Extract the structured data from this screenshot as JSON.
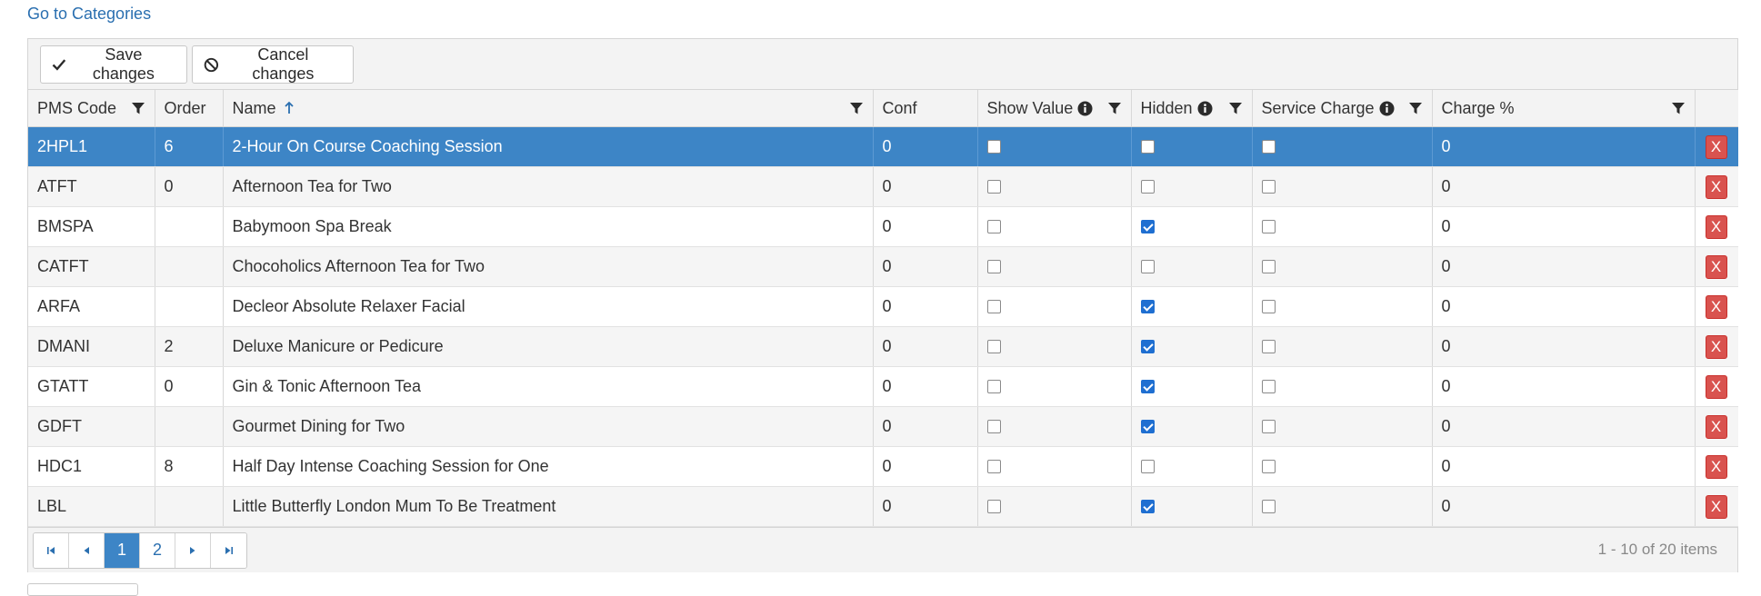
{
  "top_link": "Go to Categories",
  "toolbar": {
    "save_label": "Save changes",
    "cancel_label": "Cancel changes"
  },
  "columns": {
    "pms_code": "PMS Code",
    "order": "Order",
    "name": "Name",
    "conf": "Conf",
    "show_value": "Show Value",
    "hidden": "Hidden",
    "service_charge": "Service Charge",
    "charge_pct": "Charge %"
  },
  "rows": [
    {
      "pms": "2HPL1",
      "order": "6",
      "name": "2-Hour On Course Coaching Session",
      "conf": "0",
      "show_value": false,
      "hidden": false,
      "service_charge": false,
      "charge": "0",
      "delete": "X"
    },
    {
      "pms": "ATFT",
      "order": "0",
      "name": "Afternoon Tea for Two",
      "conf": "0",
      "show_value": false,
      "hidden": false,
      "service_charge": false,
      "charge": "0",
      "delete": "X"
    },
    {
      "pms": "BMSPA",
      "order": "",
      "name": "Babymoon Spa Break",
      "conf": "0",
      "show_value": false,
      "hidden": true,
      "service_charge": false,
      "charge": "0",
      "delete": "X"
    },
    {
      "pms": "CATFT",
      "order": "",
      "name": "Chocoholics Afternoon Tea for Two",
      "conf": "0",
      "show_value": false,
      "hidden": false,
      "service_charge": false,
      "charge": "0",
      "delete": "X"
    },
    {
      "pms": "ARFA",
      "order": "",
      "name": "Decleor Absolute Relaxer Facial",
      "conf": "0",
      "show_value": false,
      "hidden": true,
      "service_charge": false,
      "charge": "0",
      "delete": "X"
    },
    {
      "pms": "DMANI",
      "order": "2",
      "name": "Deluxe Manicure or Pedicure",
      "conf": "0",
      "show_value": false,
      "hidden": true,
      "service_charge": false,
      "charge": "0",
      "delete": "X"
    },
    {
      "pms": "GTATT",
      "order": "0",
      "name": "Gin & Tonic Afternoon Tea",
      "conf": "0",
      "show_value": false,
      "hidden": true,
      "service_charge": false,
      "charge": "0",
      "delete": "X"
    },
    {
      "pms": "GDFT",
      "order": "",
      "name": "Gourmet Dining for Two",
      "conf": "0",
      "show_value": false,
      "hidden": true,
      "service_charge": false,
      "charge": "0",
      "delete": "X"
    },
    {
      "pms": "HDC1",
      "order": "8",
      "name": "Half Day Intense Coaching Session for One",
      "conf": "0",
      "show_value": false,
      "hidden": false,
      "service_charge": false,
      "charge": "0",
      "delete": "X"
    },
    {
      "pms": "LBL",
      "order": "",
      "name": "Little Butterfly London Mum To Be Treatment",
      "conf": "0",
      "show_value": false,
      "hidden": true,
      "service_charge": false,
      "charge": "0",
      "delete": "X"
    }
  ],
  "pager": {
    "pages": [
      "1",
      "2"
    ],
    "current_page": "1",
    "info": "1 - 10 of 20 items"
  },
  "colors": {
    "selected_row": "#3d85c6",
    "link": "#2a6fb0",
    "delete": "#d9534f",
    "checkbox_checked": "#1f6fd1"
  }
}
